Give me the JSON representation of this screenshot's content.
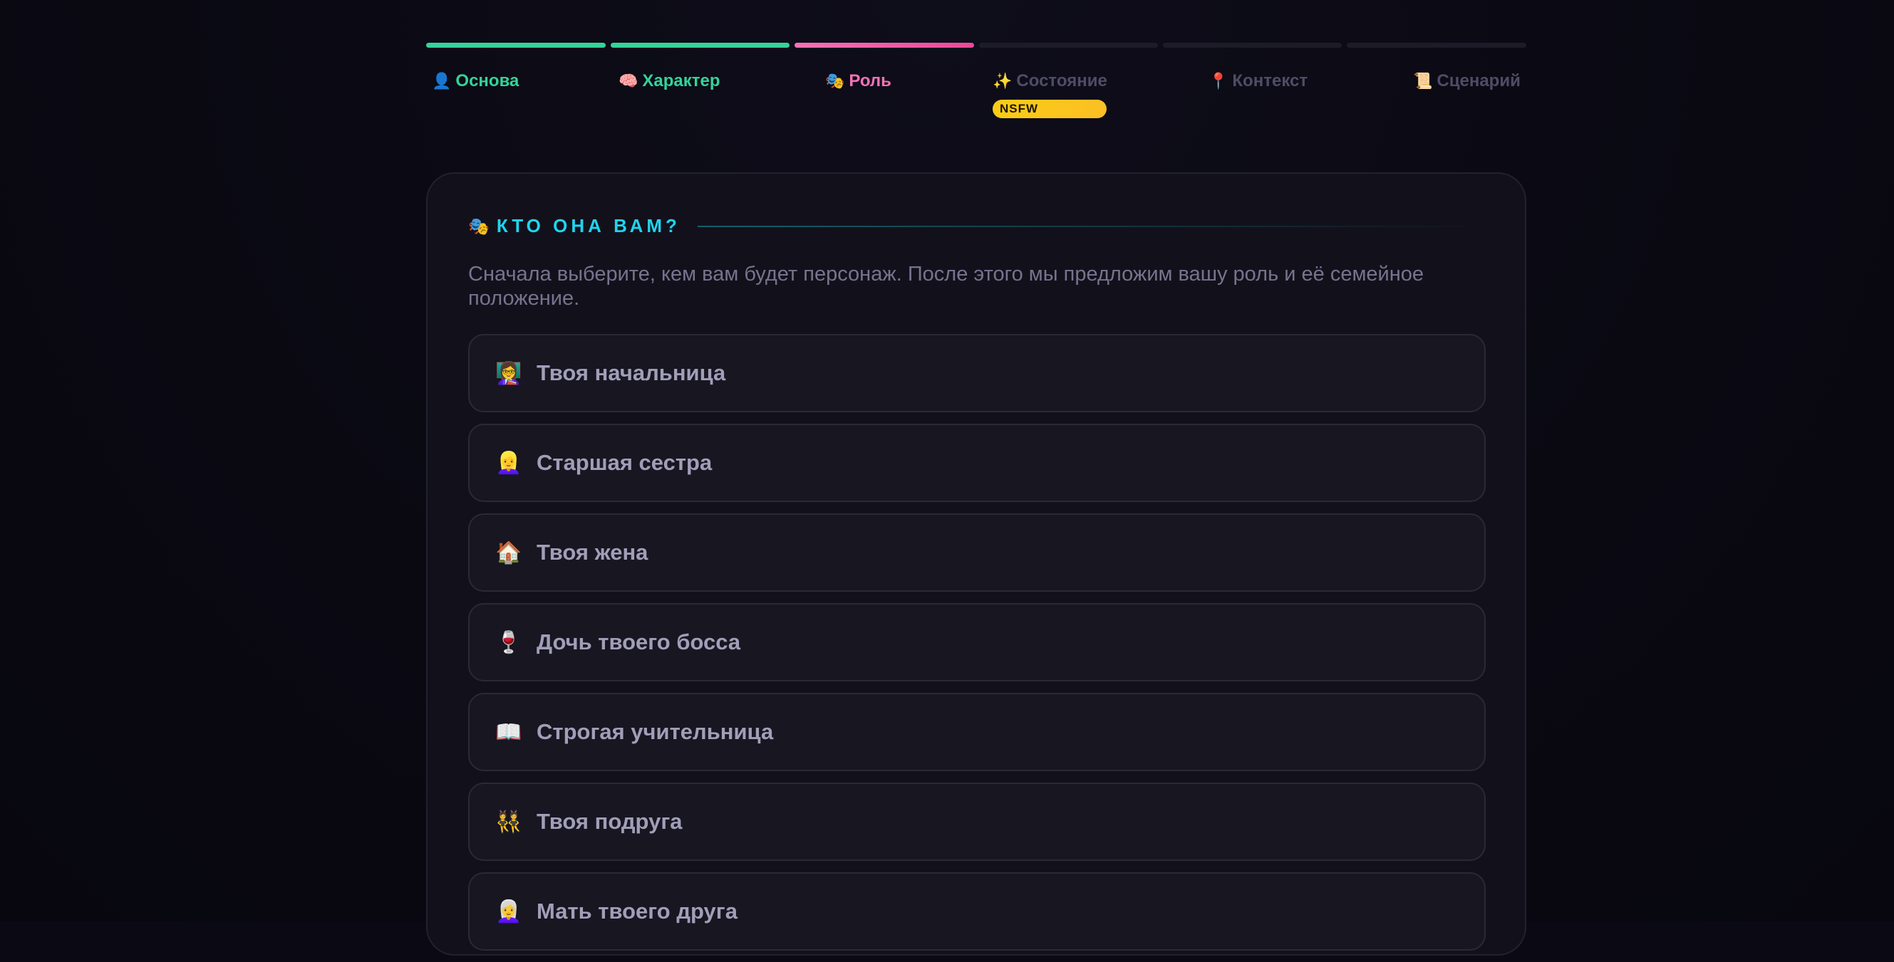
{
  "stepper": {
    "steps": [
      {
        "icon": "person-icon",
        "glyph": "👤",
        "label": "Основа",
        "state": "done"
      },
      {
        "icon": "brain-icon",
        "glyph": "🧠",
        "label": "Характер",
        "state": "done"
      },
      {
        "icon": "theater-masks-icon",
        "glyph": "🎭",
        "label": "Роль",
        "state": "active"
      },
      {
        "icon": "sparkles-icon",
        "glyph": "✨",
        "label": "Состояние",
        "state": "todo"
      },
      {
        "icon": "pin-icon",
        "glyph": "📍",
        "label": "Контекст",
        "state": "todo"
      },
      {
        "icon": "scroll-icon",
        "glyph": "📜",
        "label": "Сценарий",
        "state": "todo"
      }
    ],
    "badge": "NSFW"
  },
  "section": {
    "icon": "theater-masks-icon",
    "glyph": "🎭",
    "title": "КТО ОНА ВАМ?",
    "description": "Сначала выберите, кем вам будет персонаж. После этого мы предложим вашу роль и её семейное положение."
  },
  "options": [
    {
      "icon": "teacher-icon",
      "glyph": "👩‍🏫",
      "label": "Твоя начальница"
    },
    {
      "icon": "woman-icon",
      "glyph": "👱‍♀️",
      "label": "Старшая сестра"
    },
    {
      "icon": "house-icon",
      "glyph": "🏠",
      "label": "Твоя жена"
    },
    {
      "icon": "wine-glass-icon",
      "glyph": "🍷",
      "label": "Дочь твоего босса"
    },
    {
      "icon": "book-icon",
      "glyph": "📖",
      "label": "Строгая учительница"
    },
    {
      "icon": "women-dancing-icon",
      "glyph": "👯",
      "label": "Твоя подруга"
    },
    {
      "icon": "older-woman-icon",
      "glyph": "👩‍🦳",
      "label": "Мать твоего друга"
    }
  ],
  "colors": {
    "done": "#34d399",
    "active": "#ec4899",
    "accent": "#22d3ee",
    "badge": "#facc15"
  }
}
